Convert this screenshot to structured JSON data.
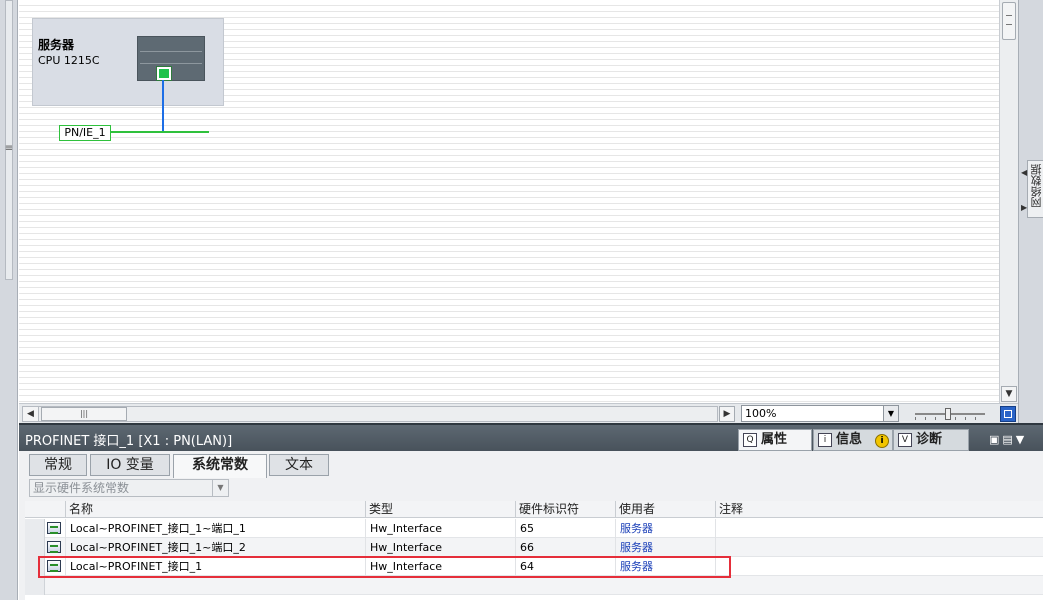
{
  "canvas": {
    "device": {
      "name": "服务器",
      "type": "CPU 1215C"
    },
    "network_label": "PN/IE_1"
  },
  "toolbar": {
    "zoom": "100%"
  },
  "right_panel": {
    "vertical_label": "网络数据"
  },
  "properties": {
    "title": "PROFINET 接口_1 [X1 : PN(LAN)]",
    "panel_tabs": {
      "properties": "属性",
      "info": "信息",
      "diagnostics": "诊断"
    },
    "tabs": [
      "常规",
      "IO 变量",
      "系统常数",
      "文本"
    ],
    "active_tab": "系统常数",
    "filter_placeholder": "显示硬件系统常数",
    "table": {
      "headers": [
        "名称",
        "类型",
        "硬件标识符",
        "使用者",
        "注释"
      ],
      "rows": [
        {
          "name": "Local~PROFINET_接口_1~端口_1",
          "type": "Hw_Interface",
          "hw_id": "65",
          "user": "服务器",
          "comment": ""
        },
        {
          "name": "Local~PROFINET_接口_1~端口_2",
          "type": "Hw_Interface",
          "hw_id": "66",
          "user": "服务器",
          "comment": ""
        },
        {
          "name": "Local~PROFINET_接口_1",
          "type": "Hw_Interface",
          "hw_id": "64",
          "user": "服务器",
          "comment": ""
        }
      ]
    }
  },
  "colors": {
    "highlight_border": "#e52e3a",
    "network_line": "#2fc13c",
    "link_line": "#1d6ee6",
    "header_bar": "#5d6872"
  }
}
